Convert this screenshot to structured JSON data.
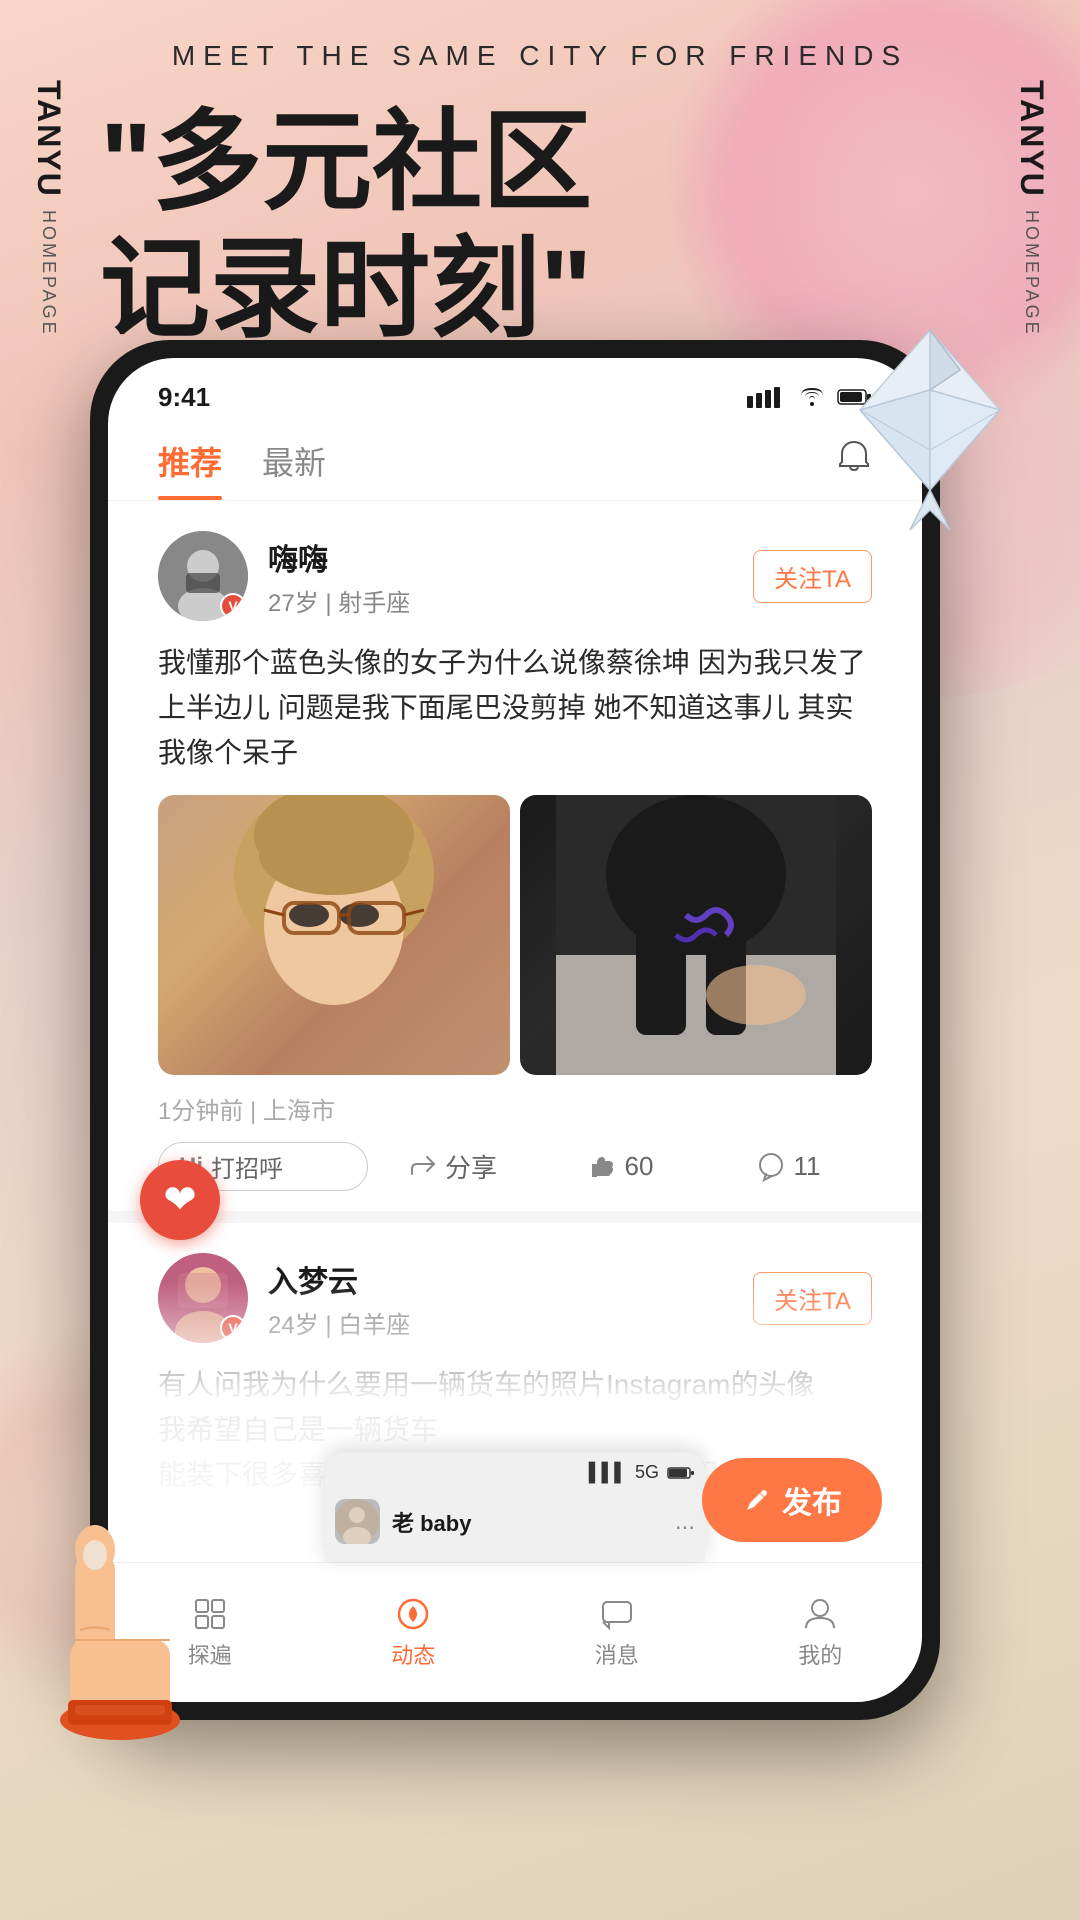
{
  "app": {
    "brand": "TANYU",
    "page": "HOMEPAGE",
    "tagline": "MEET THE SAME CITY FOR FRIENDS",
    "headline_line1": "\"多元社区",
    "headline_line2": "记录时刻\""
  },
  "status_bar": {
    "time": "9:41",
    "signal": "▌▌▌",
    "wifi": "WiFi",
    "battery": "🔋"
  },
  "nav": {
    "tab_recommended": "推荐",
    "tab_latest": "最新",
    "active_tab": "recommended"
  },
  "posts": [
    {
      "id": "post1",
      "username": "嗨嗨",
      "age": "27岁",
      "zodiac": "射手座",
      "verified": true,
      "follow_label": "关注TA",
      "text": "我懂那个蓝色头像的女子为什么说像蔡徐坤 因为我只发了上半边儿 问题是我下面尾巴没剪掉 她不知道这事儿 其实我像个呆子",
      "location": "1分钟前 | 上海市",
      "likes": "60",
      "comments": "11",
      "actions": {
        "greet": "打招呼",
        "share": "分享",
        "like_count": "60",
        "comment_count": "11"
      }
    },
    {
      "id": "post2",
      "username": "入梦云",
      "age": "24岁",
      "zodiac": "白羊座",
      "verified": true,
      "follow_label": "关注TA",
      "text_line1": "有人问我为什么要用一辆货车的照片Instagram的头像",
      "text_line2": "我希望自己是一辆货车",
      "text_line3": "能装下很多喜欢的东西，也能装下很多的你们"
    }
  ],
  "bottom_nav": {
    "explore_label": "探遍",
    "feed_label": "动态",
    "messages_label": "消息",
    "profile_label": "我的",
    "active": "feed"
  },
  "publish_btn": "发布",
  "nested_phone": {
    "signal": "▌▌▌",
    "network": "5G",
    "chat_name": "老 baby",
    "more_icon": "..."
  }
}
